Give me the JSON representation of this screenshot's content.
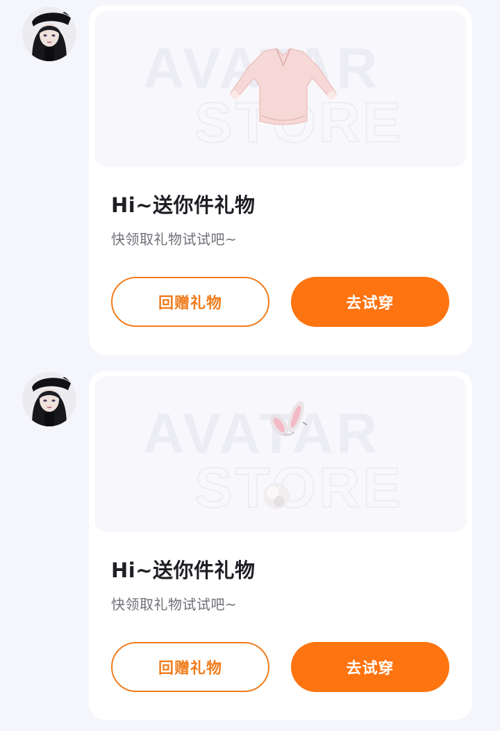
{
  "theme": {
    "accent": "#fe7410",
    "outline": "#f07c1c",
    "page_bg": "#f5f6fb",
    "card_bg": "#ffffff"
  },
  "messages": [
    {
      "sender_avatar": "gothic-girl-avatar",
      "card": {
        "preview_watermark": [
          "AVATAR",
          "STORE"
        ],
        "item_icon": "pink-blouse-item",
        "title": "Hi~送你件礼物",
        "subtitle": "快领取礼物试试吧~",
        "return_gift_label": "回赠礼物",
        "try_on_label": "去试穿"
      }
    },
    {
      "sender_avatar": "gothic-girl-avatar",
      "card": {
        "preview_watermark": [
          "AVATAR",
          "STORE"
        ],
        "item_icon": "bunny-ears-tail-item",
        "title": "Hi~送你件礼物",
        "subtitle": "快领取礼物试试吧~",
        "return_gift_label": "回赠礼物",
        "try_on_label": "去试穿"
      }
    }
  ]
}
